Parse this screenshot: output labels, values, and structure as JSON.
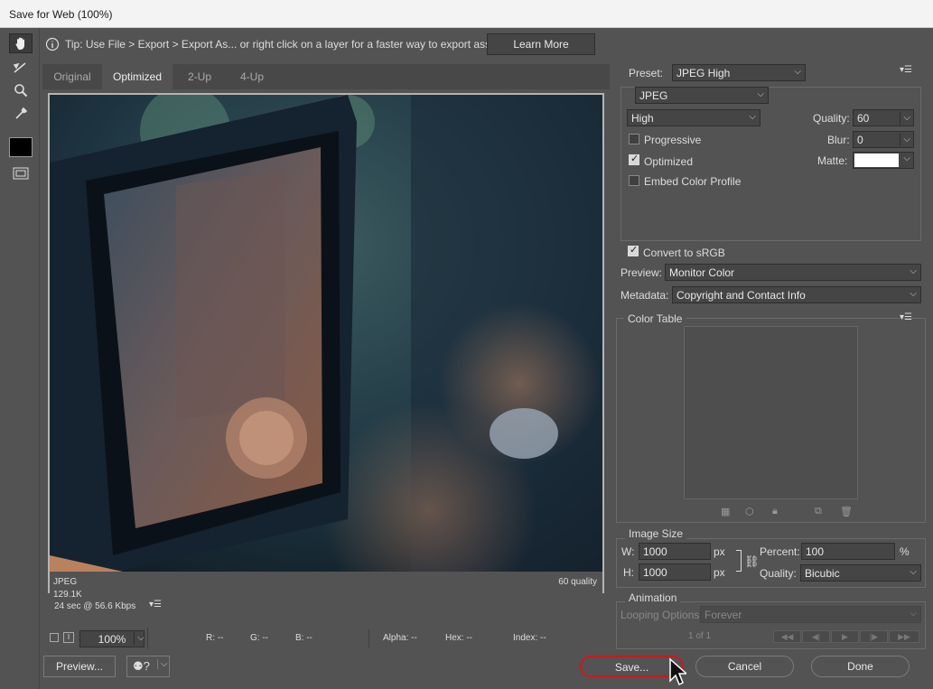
{
  "window": {
    "title": "Save for Web (100%)"
  },
  "tip": {
    "text": "Tip: Use File > Export > Export As...  or right click on a layer for a faster way to export assets",
    "learn_more": "Learn More"
  },
  "tabs": [
    "Original",
    "Optimized",
    "2-Up",
    "4-Up"
  ],
  "image_info": {
    "format": "JPEG",
    "size": "129.1K",
    "timing": "24 sec @ 56.6 Kbps",
    "quality": "60 quality"
  },
  "statusbar": {
    "zoom": "100%",
    "r": "R: --",
    "g": "G: --",
    "b": "B: --",
    "alpha": "Alpha: --",
    "hex": "Hex: --",
    "index": "Index: --"
  },
  "settings": {
    "preset_label": "Preset:",
    "preset": "JPEG High",
    "format": "JPEG",
    "compression": "High",
    "quality_label": "Quality:",
    "quality": "60",
    "blur_label": "Blur:",
    "blur": "0",
    "matte_label": "Matte:",
    "progressive": "Progressive",
    "optimized": "Optimized",
    "embed_profile": "Embed Color Profile",
    "convert_srgb": "Convert to sRGB",
    "preview_label": "Preview:",
    "preview": "Monitor Color",
    "metadata_label": "Metadata:",
    "metadata": "Copyright and Contact Info"
  },
  "color_table": {
    "title": "Color Table"
  },
  "image_size": {
    "title": "Image Size",
    "w_label": "W:",
    "w": "1000",
    "h_label": "H:",
    "h": "1000",
    "unit": "px",
    "percent_label": "Percent:",
    "percent": "100",
    "percent_unit": "%",
    "quality_label": "Quality:",
    "quality": "Bicubic"
  },
  "animation": {
    "title": "Animation",
    "looping_label": "Looping Options:",
    "looping": "Forever",
    "frame": "1 of 1"
  },
  "buttons": {
    "preview": "Preview...",
    "save": "Save...",
    "cancel": "Cancel",
    "done": "Done"
  },
  "colors": {
    "save_highlight": "#d0161e",
    "panel_bg": "#535353",
    "field_bg": "#454545"
  }
}
